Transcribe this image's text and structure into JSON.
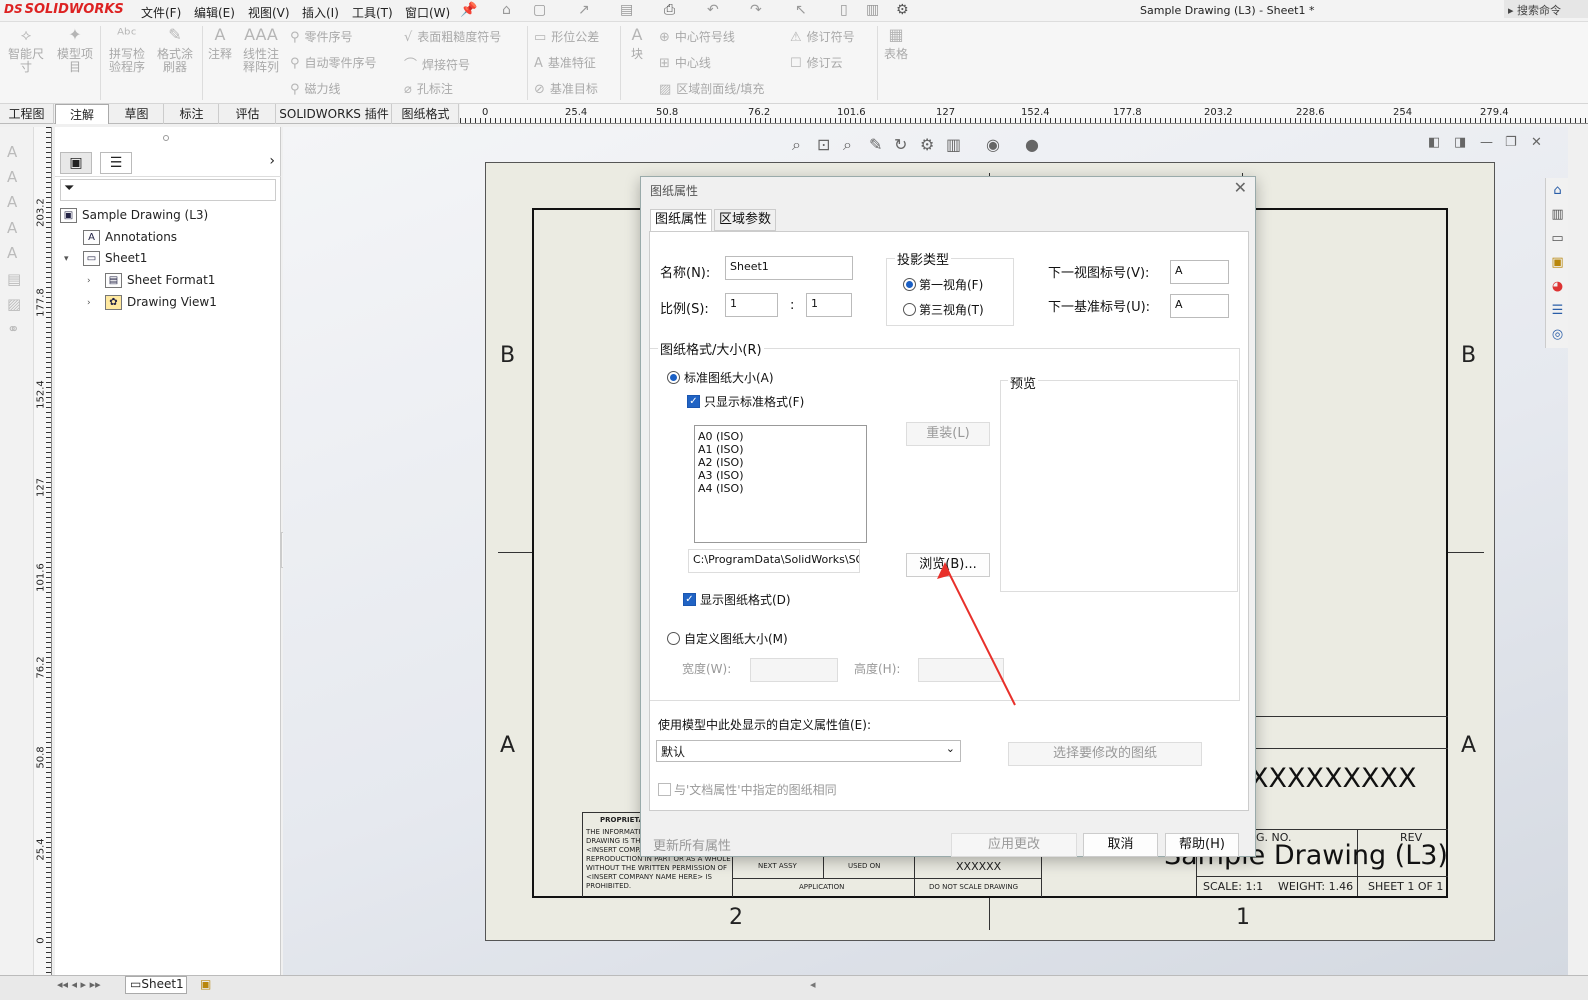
{
  "app": {
    "logo": "SOLIDWORKS",
    "doc_title": "Sample Drawing (L3) - Sheet1 *",
    "search": "搜索命令"
  },
  "menu": [
    "文件(F)",
    "编辑(E)",
    "视图(V)",
    "插入(I)",
    "工具(T)",
    "窗口(W)"
  ],
  "ribbon": {
    "big": [
      "智能尺寸",
      "模型项目",
      "拼写检验程序",
      "格式涂刷器",
      "注释",
      "线性注释阵列",
      "块",
      "表格"
    ],
    "small": [
      "零件序号",
      "自动零件序号",
      "磁力线",
      "表面粗糙度符号",
      "焊接符号",
      "孔标注",
      "形位公差",
      "基准特征",
      "基准目标",
      "中心符号线",
      "中心线",
      "区域剖面线/填充",
      "修订符号",
      "修订云"
    ]
  },
  "tabs": [
    "工程图",
    "注解",
    "草图",
    "标注",
    "评估",
    "SOLIDWORKS 插件",
    "图纸格式"
  ],
  "ruler_h": [
    "0",
    "25.4",
    "50.8",
    "76.2",
    "101.6",
    "127",
    "152.4",
    "177.8",
    "203.2",
    "228.6",
    "254",
    "279.4"
  ],
  "ruler_v": [
    "203.2",
    "177.8",
    "152.4",
    "127",
    "101.6",
    "76.2",
    "50.8",
    "25.4",
    "0"
  ],
  "tree": [
    {
      "label": "Sample Drawing (L3)",
      "icon": "drawing-icon"
    },
    {
      "label": "Annotations",
      "icon": "annotations-icon"
    },
    {
      "label": "Sheet1",
      "icon": "sheet-icon"
    },
    {
      "label": "Sheet Format1",
      "icon": "sheet-format-icon"
    },
    {
      "label": "Drawing View1",
      "icon": "drawing-view-icon"
    }
  ],
  "sheet": {
    "zones": [
      "B",
      "B",
      "A",
      "A",
      "2",
      "1"
    ],
    "title_xxx": "XXXXXXXXX",
    "dwg_no": "G. NO.",
    "rev": "REV",
    "title": "Sample Drawing (L3)",
    "scale": "SCALE: 1:1",
    "weight": "WEIGHT: 1.46",
    "sheet_of": "SHEET 1 OF 1",
    "proprietary": "PROPRIETAR",
    "prop_text": [
      "THE INFORMATIO",
      "DRAWING IS THE",
      "<INSERT COMPA",
      "REPRODUCTION IN PART OR AS A WHOLE",
      "WITHOUT THE WRITTEN PERMISSION OF",
      "<INSERT COMPANY NAME HERE> IS",
      "PROHIBITED."
    ],
    "next_assy": "NEXT ASSY",
    "used_on": "USED ON",
    "application": "APPLICATION",
    "finish": "XXXXXX",
    "do_not_scale": "DO NOT SCALE DRAWING"
  },
  "dialog": {
    "title": "图纸属性",
    "tabs": [
      "图纸属性",
      "区域参数"
    ],
    "name_label": "名称(N):",
    "name_value": "Sheet1",
    "scale_label": "比例(S):",
    "scale_a": "1",
    "scale_colon": ":",
    "scale_b": "1",
    "projection_title": "投影类型",
    "first_angle": "第一视角(F)",
    "third_angle": "第三视角(T)",
    "next_view_label": "下一视图标号(V):",
    "next_view_value": "A",
    "next_datum_label": "下一基准标号(U):",
    "next_datum_value": "A",
    "format_group": "图纸格式/大小(R)",
    "standard_size": "标准图纸大小(A)",
    "only_standard": "只显示标准格式(F)",
    "sizes": [
      "A0 (ISO)",
      "A1 (ISO)",
      "A2 (ISO)",
      "A3 (ISO)",
      "A4 (ISO)"
    ],
    "reload": "重装(L)",
    "preview": "预览",
    "path": "C:\\ProgramData\\SolidWorks\\SOL",
    "browse": "浏览(B)...",
    "show_format": "显示图纸格式(D)",
    "custom_size": "自定义图纸大小(M)",
    "width_label": "宽度(W):",
    "height_label": "高度(H):",
    "custom_prop_label": "使用模型中此处显示的自定义属性值(E):",
    "custom_prop_value": "默认",
    "select_sheets": "选择要修改的图纸",
    "same_as_doc": "与'文档属性'中指定的图纸相同",
    "update_all": "更新所有属性",
    "apply": "应用更改",
    "cancel": "取消",
    "help": "帮助(H)"
  },
  "statusbar": {
    "sheet_tab": "Sheet1"
  },
  "colors": {
    "accent": "#2063c4",
    "arrow": "#e8302a",
    "logo": "#d22222"
  }
}
